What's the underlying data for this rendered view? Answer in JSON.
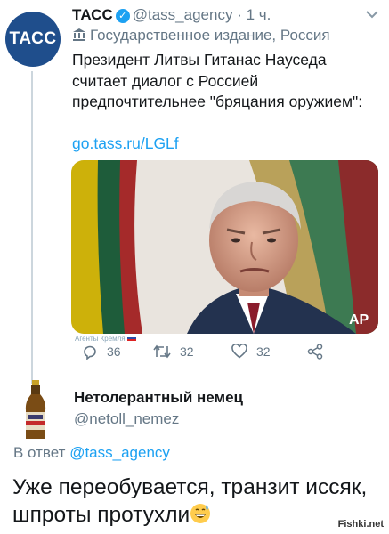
{
  "tweet": {
    "avatar_text": "ТАСС",
    "name": "ТАСС",
    "handle": "@tass_agency",
    "separator": "·",
    "time": "1 ч.",
    "label": "Государственное издание, Россия",
    "text": "Президент Литвы Гитанас Науседа считает диалог с Россией предпочтительнее \"бряцания оружием\":",
    "link": "go.tass.ru/LGLf",
    "photo_watermark": "Агенты Кремля",
    "photo_credit": "AP",
    "actions": {
      "replies": "36",
      "retweets": "32",
      "likes": "32"
    },
    "icons": [
      "verified-badge-icon",
      "government-building-icon",
      "chevron-down-icon",
      "reply-icon",
      "retweet-icon",
      "like-icon",
      "share-icon"
    ]
  },
  "reply": {
    "name": "Нетолерантный немец",
    "handle": "@netoll_nemez",
    "in_reply_prefix": "В ответ",
    "in_reply_handle": "@tass_agency",
    "text": "Уже переобувается, транзит иссяк, шпроты протухли",
    "emoji": "grinning-sweat-emoji"
  },
  "site_watermark": "Fishki.net",
  "colors": {
    "link": "#1da1f2",
    "secondary_text": "#657786",
    "tass_blue": "#1f4e8c"
  }
}
